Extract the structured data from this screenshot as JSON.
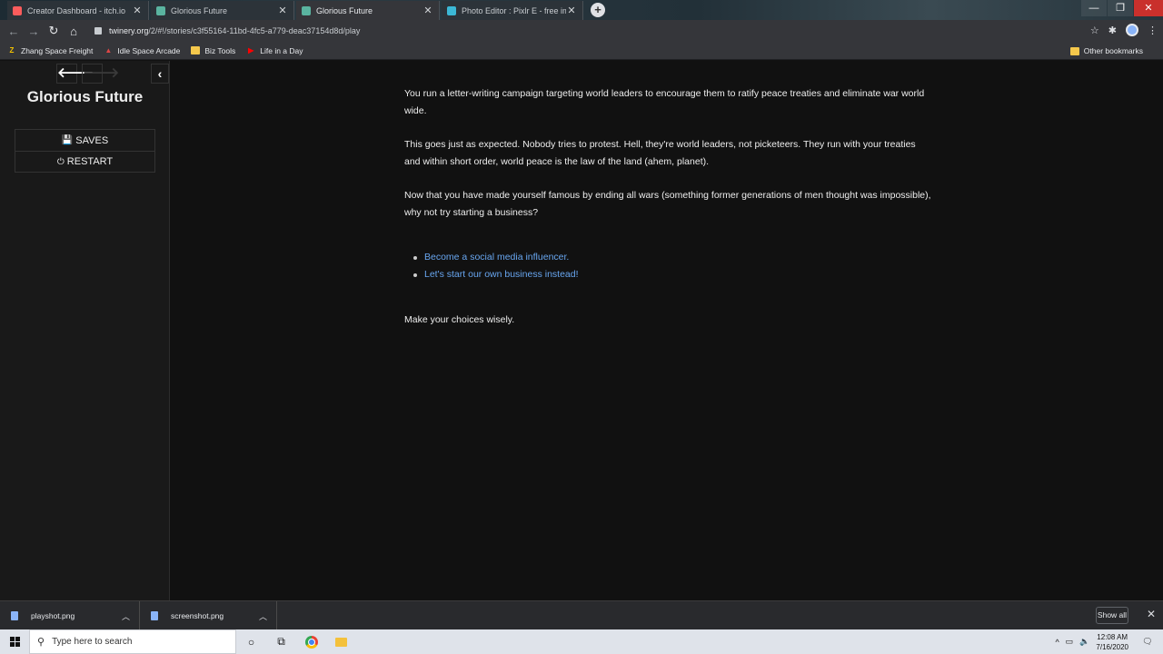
{
  "browser": {
    "tabs": [
      {
        "label": "Creator Dashboard - itch.io",
        "favicon_color": "#fa5c5c",
        "active": false
      },
      {
        "label": "Glorious Future",
        "favicon_color": "#5ab4a0",
        "active": false
      },
      {
        "label": "Glorious Future",
        "favicon_color": "#5ab4a0",
        "active": true
      },
      {
        "label": "Photo Editor : Pixlr E - free image",
        "favicon_color": "#3bb8d6",
        "active": false
      }
    ],
    "new_tab_glyph": "+",
    "window_buttons": {
      "minimize": "—",
      "maximize": "❐",
      "close": "✕"
    },
    "url_host": "twinery.org",
    "url_path": "/2/#!/stories/c3f55164-11bd-4fc5-a779-deac37154d8d/play",
    "bookmarks": [
      {
        "label": "Zhang Space Freight",
        "icon": "z-logo-icon",
        "icon_glyph": "Z",
        "icon_color": "#f5c400"
      },
      {
        "label": "Idle Space Arcade",
        "icon": "arcade-icon",
        "icon_glyph": "▲",
        "icon_color": "#e04646"
      },
      {
        "label": "Biz Tools",
        "icon": "folder-icon",
        "icon_glyph": "",
        "icon_color": "#f5c84c"
      },
      {
        "label": "Life in a Day",
        "icon": "youtube-icon",
        "icon_glyph": "▶",
        "icon_color": "#ff0000"
      }
    ],
    "other_bookmarks": "Other bookmarks"
  },
  "story": {
    "title": "Glorious Future",
    "menu": {
      "saves_label": "SAVES",
      "restart_label": "RESTART"
    },
    "passage": [
      "You run a letter-writing campaign targeting world leaders to encourage them to ratify peace treaties and eliminate war world wide.",
      "This goes just as expected. Nobody tries to protest. Hell, they're world leaders, not picketeers. They run with your treaties and within short order, world peace is the law of the land (ahem, planet).",
      "Now that you have made yourself famous by ending all wars (something former generations of men thought was impossible), why not try starting a business?"
    ],
    "choices": [
      "Become a social media influencer.",
      "Let's start our own business instead!"
    ],
    "footer": "Make your choices wisely.",
    "link_color": "#68a6f0"
  },
  "downloads": {
    "items": [
      {
        "name": "playshot.png"
      },
      {
        "name": "screenshot.png"
      }
    ],
    "show_all": "Show all"
  },
  "taskbar": {
    "search_placeholder": "Type here to search",
    "time": "12:08 AM",
    "date": "7/16/2020"
  }
}
